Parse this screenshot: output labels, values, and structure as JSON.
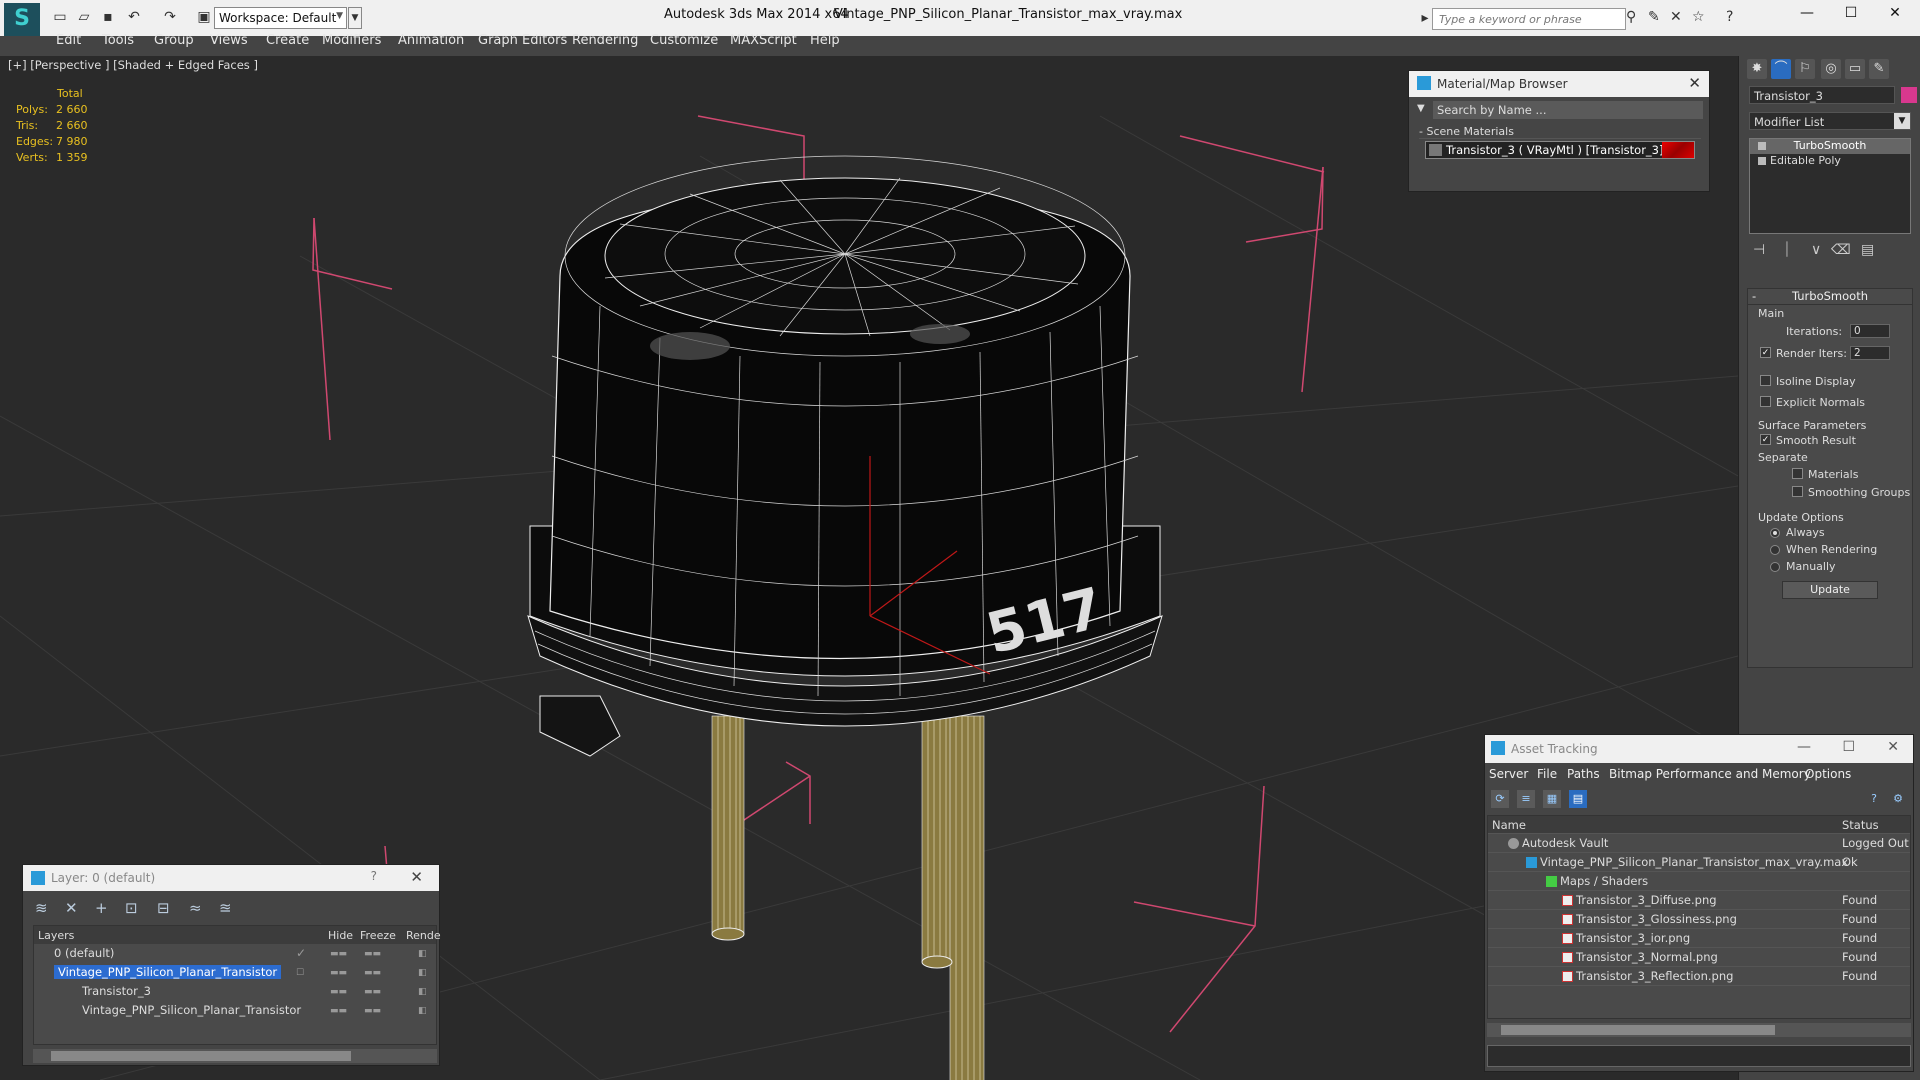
{
  "titlebar": {
    "workspace": "Workspace: Default",
    "app_title": "Autodesk 3ds Max  2014 x64",
    "doc_name": "Vintage_PNP_Silicon_Planar_Transistor_max_vray.max",
    "search_placeholder": "Type a keyword or phrase"
  },
  "menus": [
    "Edit",
    "Tools",
    "Group",
    "Views",
    "Create",
    "Modifiers",
    "Animation",
    "Graph Editors",
    "Rendering",
    "Customize",
    "MAXScript",
    "Help"
  ],
  "viewport": {
    "label": "[+] [Perspective ] [Shaded + Edged Faces ]",
    "stats_header": "Total",
    "stats": [
      {
        "k": "Polys:",
        "v": "2 660"
      },
      {
        "k": "Tris:",
        "v": "2 660"
      },
      {
        "k": "Edges:",
        "v": "7 980"
      },
      {
        "k": "Verts:",
        "v": "1 359"
      }
    ],
    "marking": "517"
  },
  "material_browser": {
    "title": "Material/Map Browser",
    "search": "Search by Name ...",
    "section": "Scene Materials",
    "item": "Transistor_3  ( VRayMtl ) [Transistor_3]"
  },
  "command_panel": {
    "object_name": "Transistor_3",
    "object_color": "#d8388e",
    "modifier_list": "Modifier List",
    "stack": [
      "TurboSmooth",
      "Editable Poly"
    ],
    "rollout_title": "TurboSmooth",
    "main_group": "Main",
    "iterations_label": "Iterations:",
    "iterations_value": "0",
    "render_iters_label": "Render Iters:",
    "render_iters_value": "2",
    "isoline": "Isoline Display",
    "explicit_normals": "Explicit Normals",
    "surface_params": "Surface Parameters",
    "smooth_result": "Smooth Result",
    "separate": "Separate",
    "materials": "Materials",
    "smoothing_groups": "Smoothing Groups",
    "update_options": "Update Options",
    "always": "Always",
    "when_rendering": "When Rendering",
    "manually": "Manually",
    "update_btn": "Update"
  },
  "layers": {
    "title": "Layer: 0 (default)",
    "help": "?",
    "columns": [
      "Layers",
      "Hide",
      "Freeze",
      "Rende"
    ],
    "rows": [
      {
        "name": "0 (default)",
        "indent": 28
      },
      {
        "name": "Vintage_PNP_Silicon_Planar_Transistor",
        "indent": 28,
        "selected": true
      },
      {
        "name": "Transistor_3",
        "indent": 48
      },
      {
        "name": "Vintage_PNP_Silicon_Planar_Transistor",
        "indent": 48
      }
    ]
  },
  "asset_tracking": {
    "title": "Asset Tracking",
    "menus": [
      "Server",
      "File",
      "Paths",
      "Bitmap Performance and Memory",
      "Options"
    ],
    "columns": [
      "Name",
      "Status"
    ],
    "rows": [
      {
        "name": "Autodesk Vault",
        "status": "Logged Out",
        "indent": 32,
        "icon": "vault"
      },
      {
        "name": "Vintage_PNP_Silicon_Planar_Transistor_max_vray.max",
        "status": "Ok",
        "indent": 56,
        "icon": "max"
      },
      {
        "name": "Maps / Shaders",
        "status": "",
        "indent": 72,
        "icon": "folder"
      },
      {
        "name": "Transistor_3_Diffuse.png",
        "status": "Found",
        "indent": 88,
        "icon": "png"
      },
      {
        "name": "Transistor_3_Glossiness.png",
        "status": "Found",
        "indent": 88,
        "icon": "png"
      },
      {
        "name": "Transistor_3_ior.png",
        "status": "Found",
        "indent": 88,
        "icon": "png"
      },
      {
        "name": "Transistor_3_Normal.png",
        "status": "Found",
        "indent": 88,
        "icon": "png"
      },
      {
        "name": "Transistor_3_Reflection.png",
        "status": "Found",
        "indent": 88,
        "icon": "png"
      }
    ]
  }
}
